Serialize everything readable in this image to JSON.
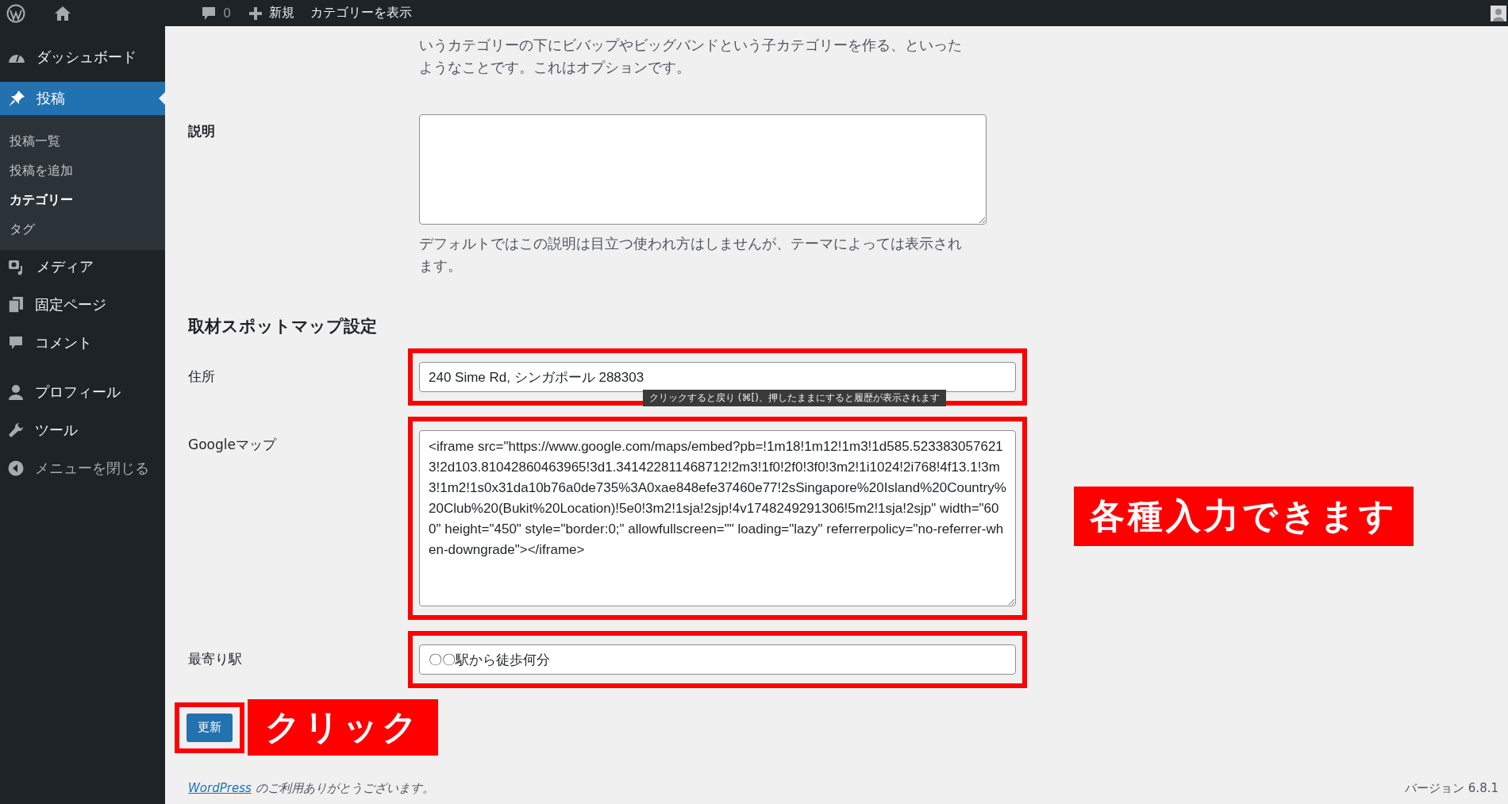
{
  "admin_bar": {
    "comment_count": "0",
    "new_label": "新規",
    "view_label": "カテゴリーを表示"
  },
  "sidebar": {
    "items": [
      {
        "label": "ダッシュボード",
        "selected": false
      },
      {
        "label": "投稿",
        "selected": true,
        "submenu": [
          {
            "label": "投稿一覧",
            "selected": false
          },
          {
            "label": "投稿を追加",
            "selected": false
          },
          {
            "label": "カテゴリー",
            "selected": true
          },
          {
            "label": "タグ",
            "selected": false
          }
        ]
      },
      {
        "label": "メディア",
        "selected": false
      },
      {
        "label": "固定ページ",
        "selected": false
      },
      {
        "label": "コメント",
        "selected": false
      },
      {
        "label": "プロフィール",
        "selected": false
      },
      {
        "label": "ツール",
        "selected": false
      }
    ],
    "collapse_label": "メニューを閉じる"
  },
  "intro_lines": [
    "いうカテゴリーの下にビバップやビッグバンドという子カテゴリーを作る、といった",
    "ようなことです。これはオプションです。"
  ],
  "description": {
    "label": "説明",
    "help": "デフォルトではこの説明は目立つ使われ方はしませんが、テーマによっては表示されます。"
  },
  "section_heading": "取材スポットマップ設定",
  "fields": [
    {
      "label": "住所",
      "kind": "input",
      "value": "240 Sime Rd, シンガポール 288303",
      "highlighted": true,
      "tooltip": "クリックすると戻り (⌘[)、押したままにすると履歴が表示されます"
    },
    {
      "label": "Googleマップ",
      "kind": "textarea",
      "value": "<iframe src=\"https://www.google.com/maps/embed?pb=!1m18!1m12!1m3!1d585.5233830576213!2d103.81042860463965!3d1.341422811468712!2m3!1f0!2f0!3f0!3m2!1i1024!2i768!4f13.1!3m3!1m2!1s0x31da10b76a0de735%3A0xae848efe37460e77!2sSingapore%20Island%20Country%20Club%20(Bukit%20Location)!5e0!3m2!1sja!2sjp!4v1748249291306!5m2!1sja!2sjp\" width=\"600\" height=\"450\" style=\"border:0;\" allowfullscreen=\"\" loading=\"lazy\" referrerpolicy=\"no-referrer-when-downgrade\"></iframe>",
      "highlighted": true
    },
    {
      "label": "最寄り駅",
      "kind": "input",
      "value": "〇〇駅から徒歩何分",
      "highlighted": true
    }
  ],
  "submit": {
    "label": "更新",
    "highlighted": true
  },
  "annotations": [
    {
      "kind": "fields",
      "text": "各種入力できます"
    },
    {
      "kind": "button",
      "text": "クリック"
    }
  ],
  "footer": {
    "link": "WordPress",
    "text": "のご利用ありがとうございます。",
    "version": "バージョン 6.8.1"
  }
}
